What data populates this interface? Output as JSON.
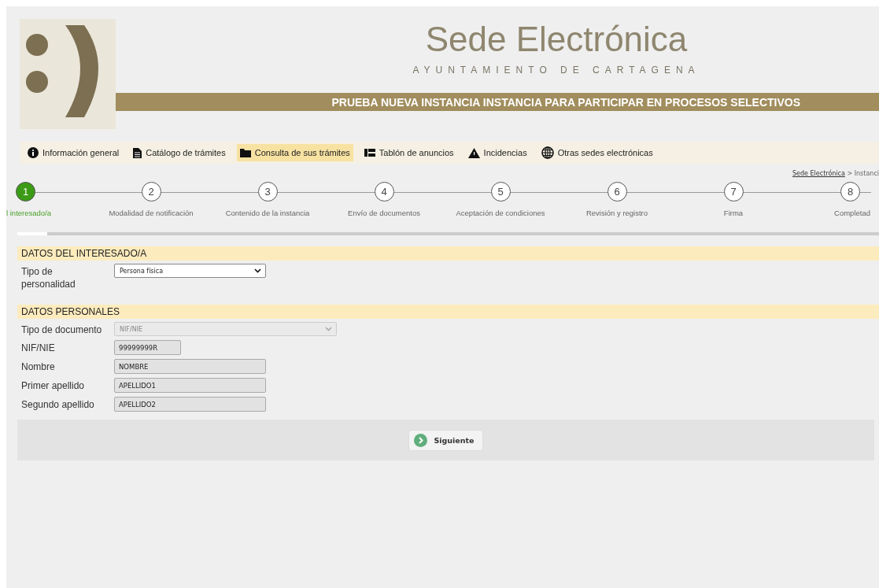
{
  "header": {
    "title": "Sede Electrónica",
    "subtitle": "AYUNTAMIENTO DE CARTAGENA",
    "banner": "PRUEBA NUEVA INSTANCIA INSTANCIA PARA PARTICIPAR EN PROCESOS SELECTIVOS"
  },
  "nav": [
    {
      "label": "Información general",
      "selected": false
    },
    {
      "label": "Catálogo de trámites",
      "selected": false
    },
    {
      "label": "Consulta de sus trámites",
      "selected": true
    },
    {
      "label": "Tablón de anuncios",
      "selected": false
    },
    {
      "label": "Incidencias",
      "selected": false
    },
    {
      "label": "Otras sedes electrónicas",
      "selected": false
    }
  ],
  "breadcrumb": {
    "link": "Sede Electrónica",
    "rest": "> Instanci"
  },
  "steps": [
    {
      "number": "1",
      "label": "l interesado/a",
      "selected": true
    },
    {
      "number": "2",
      "label": "Modalidad de notificación",
      "selected": false
    },
    {
      "number": "3",
      "label": "Contenido de la instancia",
      "selected": false
    },
    {
      "number": "4",
      "label": "Envío de documentos",
      "selected": false
    },
    {
      "number": "5",
      "label": "Aceptación de condiciones",
      "selected": false
    },
    {
      "number": "6",
      "label": "Revisión y registro",
      "selected": false
    },
    {
      "number": "7",
      "label": "Firma",
      "selected": false
    },
    {
      "number": "8",
      "label": "Completad",
      "selected": false
    }
  ],
  "sections": [
    {
      "title": "DATOS DEL INTERESADO/A",
      "fields": [
        {
          "label": "Tipo de personalidad",
          "kind": "select",
          "value": "Persona física",
          "disabled": false
        }
      ]
    },
    {
      "title": "DATOS PERSONALES",
      "fields": [
        {
          "label": "Tipo de documento",
          "kind": "select",
          "value": "NIF/NIE",
          "disabled": true
        },
        {
          "label": "NIF/NIE",
          "kind": "text",
          "value": "99999999R",
          "disabled": true
        },
        {
          "label": "Nombre",
          "kind": "text",
          "value": "NOMBRE",
          "disabled": true
        },
        {
          "label": "Primer apellido",
          "kind": "text",
          "value": "APELLIDO1",
          "disabled": true
        },
        {
          "label": "Segundo apellido",
          "kind": "text",
          "value": "APELLIDO2",
          "disabled": true
        }
      ]
    }
  ],
  "next_button": "Siguiente"
}
